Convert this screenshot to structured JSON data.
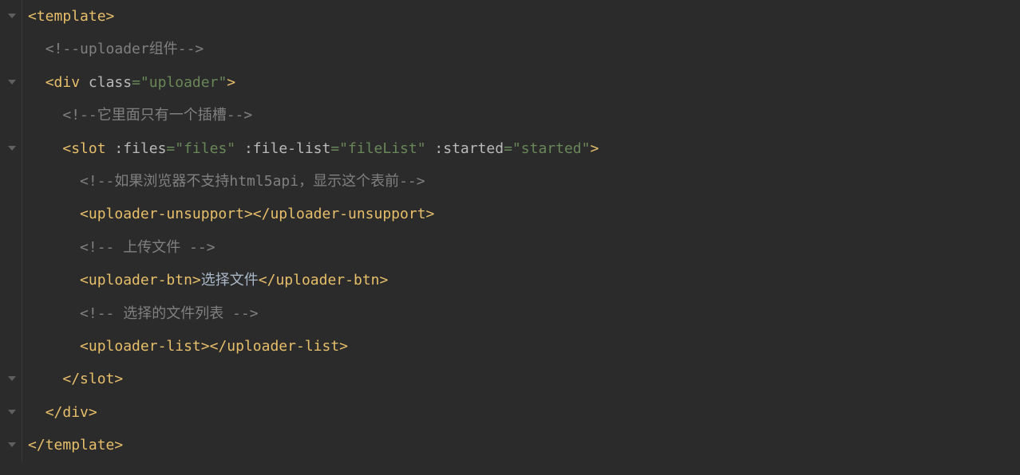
{
  "lines": [
    {
      "indent": 0,
      "segments": [
        {
          "type": "bracket",
          "text": "<"
        },
        {
          "type": "tag",
          "text": "template"
        },
        {
          "type": "bracket",
          "text": ">"
        }
      ]
    },
    {
      "indent": 1,
      "segments": [
        {
          "type": "comment",
          "text": "<!--uploader组件-->"
        }
      ]
    },
    {
      "indent": 1,
      "segments": [
        {
          "type": "bracket",
          "text": "<"
        },
        {
          "type": "tag",
          "text": "div "
        },
        {
          "type": "attr-name",
          "text": "class"
        },
        {
          "type": "attr-value",
          "text": "=\"uploader\""
        },
        {
          "type": "bracket",
          "text": ">"
        }
      ]
    },
    {
      "indent": 2,
      "segments": [
        {
          "type": "comment",
          "text": "<!--它里面只有一个插槽-->"
        }
      ]
    },
    {
      "indent": 2,
      "segments": [
        {
          "type": "bracket",
          "text": "<"
        },
        {
          "type": "tag",
          "text": "slot "
        },
        {
          "type": "attr-name",
          "text": ":files"
        },
        {
          "type": "attr-value",
          "text": "=\"files\" "
        },
        {
          "type": "attr-name",
          "text": ":file-list"
        },
        {
          "type": "attr-value",
          "text": "=\"fileList\" "
        },
        {
          "type": "attr-name",
          "text": ":started"
        },
        {
          "type": "attr-value",
          "text": "=\"started\""
        },
        {
          "type": "bracket",
          "text": ">"
        }
      ]
    },
    {
      "indent": 3,
      "segments": [
        {
          "type": "comment",
          "text": "<!--如果浏览器不支持html5api，显示这个表前-->"
        }
      ]
    },
    {
      "indent": 3,
      "segments": [
        {
          "type": "bracket",
          "text": "<"
        },
        {
          "type": "tag",
          "text": "uploader-unsupport"
        },
        {
          "type": "bracket",
          "text": "></"
        },
        {
          "type": "tag",
          "text": "uploader-unsupport"
        },
        {
          "type": "bracket",
          "text": ">"
        }
      ]
    },
    {
      "indent": 3,
      "segments": [
        {
          "type": "comment",
          "text": "<!-- 上传文件 -->"
        }
      ]
    },
    {
      "indent": 3,
      "segments": [
        {
          "type": "bracket",
          "text": "<"
        },
        {
          "type": "tag",
          "text": "uploader-btn"
        },
        {
          "type": "bracket",
          "text": ">"
        },
        {
          "type": "text-content",
          "text": "选择文件"
        },
        {
          "type": "bracket",
          "text": "</"
        },
        {
          "type": "tag",
          "text": "uploader-btn"
        },
        {
          "type": "bracket",
          "text": ">"
        }
      ]
    },
    {
      "indent": 3,
      "segments": [
        {
          "type": "comment",
          "text": "<!-- 选择的文件列表 -->"
        }
      ]
    },
    {
      "indent": 3,
      "segments": [
        {
          "type": "bracket",
          "text": "<"
        },
        {
          "type": "tag",
          "text": "uploader-list"
        },
        {
          "type": "bracket",
          "text": "></"
        },
        {
          "type": "tag",
          "text": "uploader-list"
        },
        {
          "type": "bracket",
          "text": ">"
        }
      ]
    },
    {
      "indent": 2,
      "segments": [
        {
          "type": "bracket",
          "text": "</"
        },
        {
          "type": "tag",
          "text": "slot"
        },
        {
          "type": "bracket",
          "text": ">"
        }
      ]
    },
    {
      "indent": 1,
      "segments": [
        {
          "type": "bracket",
          "text": "</"
        },
        {
          "type": "tag",
          "text": "div"
        },
        {
          "type": "bracket",
          "text": ">"
        }
      ]
    },
    {
      "indent": 0,
      "segments": [
        {
          "type": "bracket",
          "text": "</"
        },
        {
          "type": "tag",
          "text": "template"
        },
        {
          "type": "bracket",
          "text": ">"
        }
      ]
    }
  ],
  "foldMarkers": [
    0,
    2,
    4,
    11,
    12,
    13
  ],
  "indentSize": "  "
}
